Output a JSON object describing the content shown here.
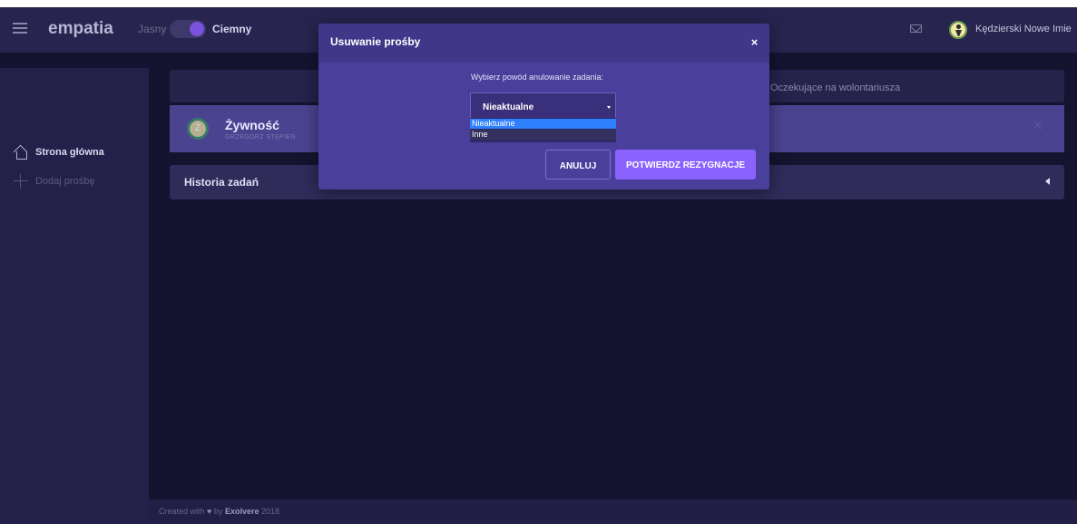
{
  "app": {
    "brand": "empatia",
    "theme_light_label": "Jasny",
    "theme_dark_label": "Ciemny",
    "theme_toggle_state": "Ciemny",
    "user_name": "Kędzierski Nowe Imie",
    "accent_color": "#7a52de"
  },
  "sidebar": {
    "items": [
      {
        "label": "Strona główna",
        "icon": "home-icon"
      },
      {
        "label": "Dodaj prośbę",
        "icon": "plus-icon"
      }
    ]
  },
  "main": {
    "tab_label": "Oczekujące na wolontariusza",
    "task": {
      "avatar_letter": "Ż",
      "title": "Żywność",
      "subtitle": "GRZEGORZ STĘPIEŃ"
    },
    "history_title": "Historia zadań"
  },
  "footer": {
    "prefix": "Created with",
    "heart": "♥",
    "by": "by",
    "brand": "Exolvere",
    "year": "2018"
  },
  "modal": {
    "title": "Usuwanie prośby",
    "close_symbol": "×",
    "prompt": "Wybierz powód anulowanie zadania:",
    "select_value": "Nieaktualne",
    "options": [
      "Nieaktualne",
      "Inne"
    ],
    "cancel_label": "ANULUJ",
    "confirm_label": "POTWIERDZ REZYGNACJE"
  }
}
